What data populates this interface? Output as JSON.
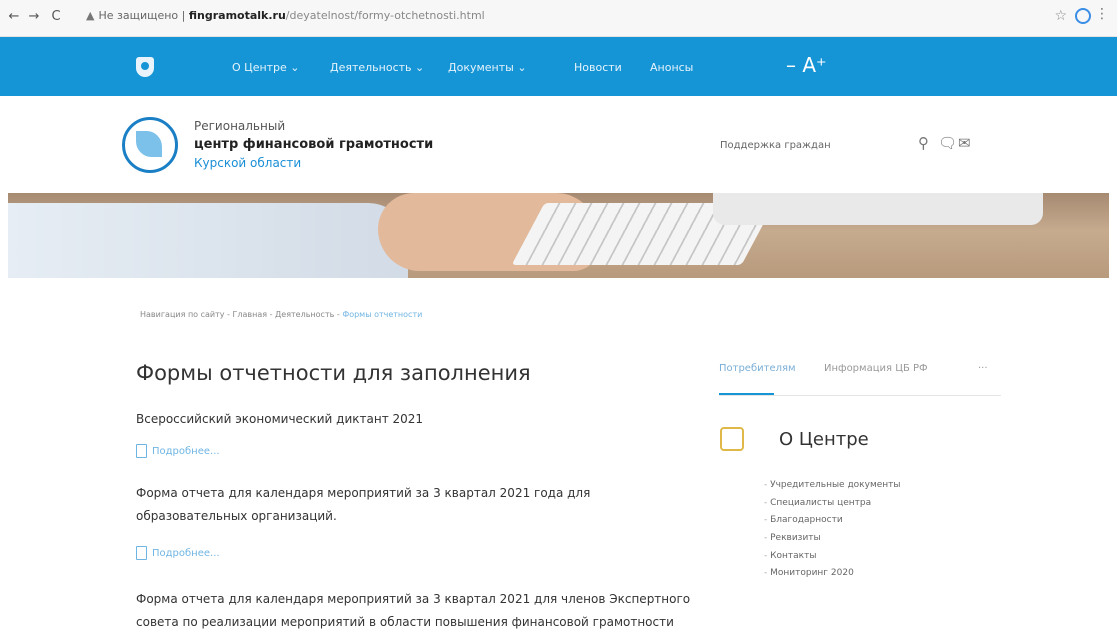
{
  "browser": {
    "back": "←",
    "forward": "→",
    "reload": "C",
    "security": "Не защищено",
    "domain": "fingramotalk.ru",
    "path": "/deyatelnost/formy-otchetnosti.html",
    "star": "☆",
    "menu": "⋮"
  },
  "nav": {
    "items": [
      "О Центре",
      "Деятельность",
      "Документы",
      "Новости",
      "Анонсы"
    ],
    "font_toggle": "– A⁺"
  },
  "header": {
    "line1": "Региональный",
    "line2": "центр финансовой грамотности",
    "line3": "Курской области",
    "support": "Поддержка граждан",
    "icons": [
      "search-icon",
      "chat-icon",
      "mail-icon"
    ]
  },
  "breadcrumb": {
    "items": [
      "Навигация по сайту",
      "Главная",
      "Деятельность"
    ],
    "active": "Формы отчетности"
  },
  "main": {
    "title": "Формы отчетности для заполнения",
    "more_label": "Подробнее...",
    "docs": [
      "Всероссийский экономический диктант 2021",
      "Форма отчета для календаря мероприятий за 3 квартал 2021 года для образовательных организаций.",
      "Форма отчета для календаря мероприятий за 3 квартал 2021 для членов Экспертного совета по реализации мероприятий в области повышения финансовой грамотности"
    ]
  },
  "sidebar": {
    "tabs": [
      "Потребителям",
      "Информация ЦБ РФ",
      "···"
    ],
    "title": "О Центре",
    "items": [
      "Учредительные документы",
      "Специалисты центра",
      "Благодарности",
      "Реквизиты",
      "Контакты",
      "Мониторинг 2020"
    ]
  },
  "colors": {
    "nav_bg": "#1595d6",
    "link": "#6fb5e3",
    "accent_yellow": "#e0b84a"
  }
}
